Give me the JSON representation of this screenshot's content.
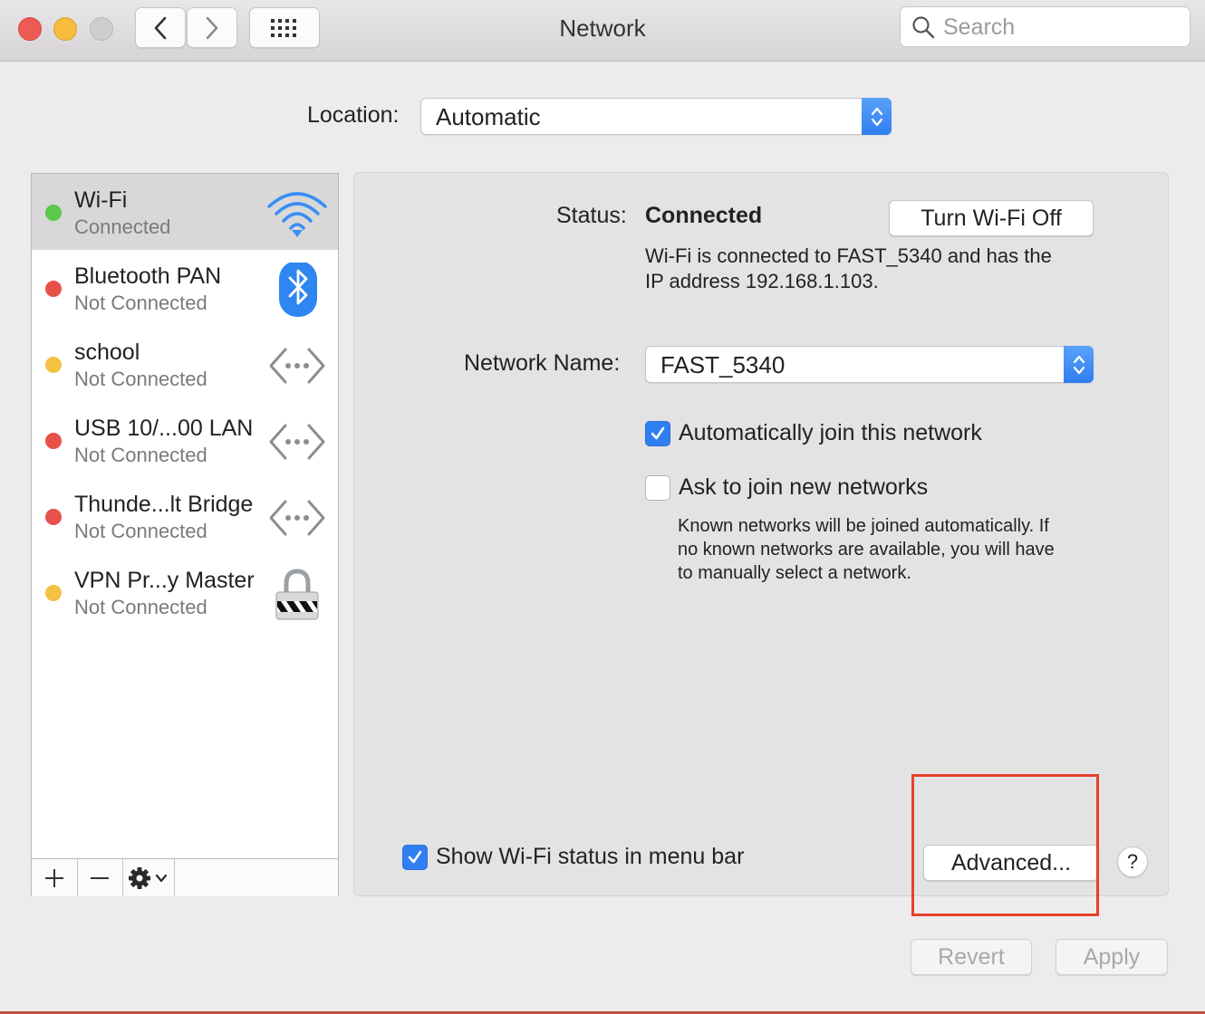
{
  "window": {
    "title": "Network"
  },
  "toolbar": {
    "search_placeholder": "Search"
  },
  "location": {
    "label": "Location:",
    "value": "Automatic"
  },
  "services": [
    {
      "name": "Wi-Fi",
      "status": "Connected",
      "dot_color": "#5ac84a",
      "icon": "wifi-icon",
      "selected": true
    },
    {
      "name": "Bluetooth PAN",
      "status": "Not Connected",
      "dot_color": "#e8504a",
      "icon": "bluetooth-icon"
    },
    {
      "name": "school",
      "status": "Not Connected",
      "dot_color": "#f4c143",
      "icon": "ethernet-icon"
    },
    {
      "name": "USB 10/...00 LAN",
      "status": "Not Connected",
      "dot_color": "#e8504a",
      "icon": "ethernet-icon"
    },
    {
      "name": "Thunde...lt Bridge",
      "status": "Not Connected",
      "dot_color": "#e8504a",
      "icon": "ethernet-icon"
    },
    {
      "name": "VPN Pr...y Master",
      "status": "Not Connected",
      "dot_color": "#f4c143",
      "icon": "vpn-lock-icon"
    }
  ],
  "detail": {
    "status_label": "Status:",
    "status_value": "Connected",
    "turn_off_label": "Turn Wi-Fi Off",
    "status_desc_line1": "Wi-Fi is connected to FAST_5340 and has the",
    "status_desc_line2": "IP address 192.168.1.103.",
    "network_name_label": "Network Name:",
    "network_name_value": "FAST_5340",
    "auto_join_label": "Automatically join this network",
    "auto_join_checked": true,
    "ask_join_label": "Ask to join new networks",
    "ask_join_checked": false,
    "ask_note_line1": "Known networks will be joined automatically. If",
    "ask_note_line2": "no known networks are available, you will have",
    "ask_note_line3": "to manually select a network.",
    "show_status_label": "Show Wi-Fi status in menu bar",
    "show_status_checked": true,
    "advanced_label": "Advanced...",
    "help_label": "?"
  },
  "footer": {
    "revert_label": "Revert",
    "apply_label": "Apply"
  },
  "colors": {
    "accent": "#2f7ef2",
    "highlight": "#e8402a"
  }
}
